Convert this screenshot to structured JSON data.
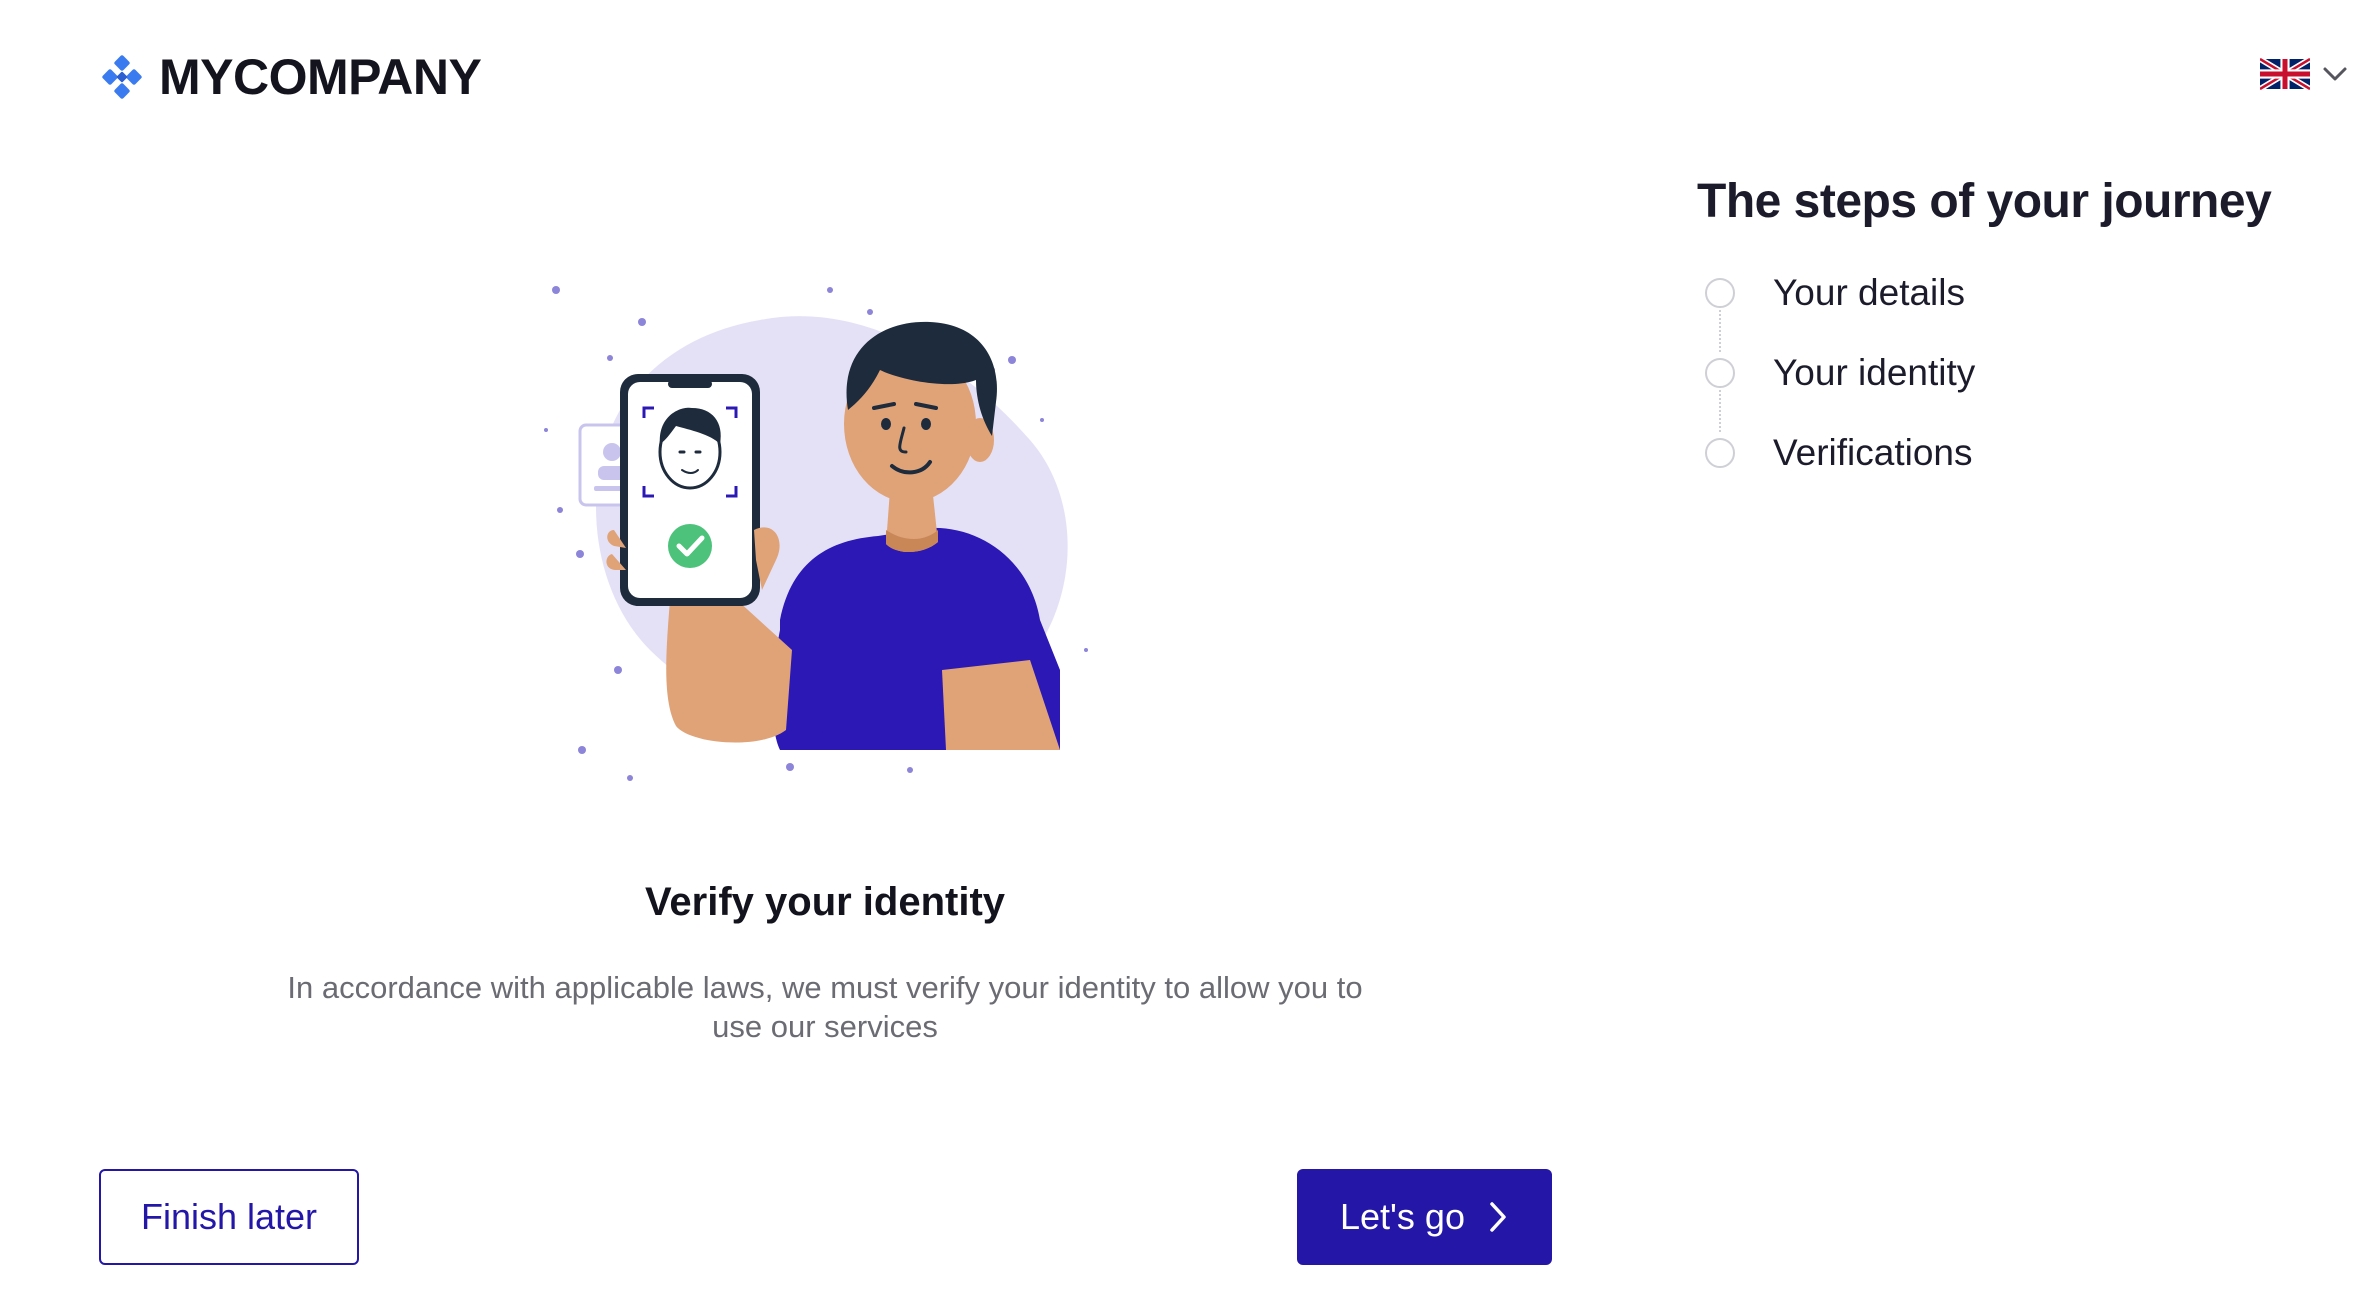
{
  "header": {
    "logo_text": "MYCOMPANY",
    "language": "English (UK)"
  },
  "main": {
    "title": "Verify your identity",
    "description": "In accordance with applicable laws, we must verify your identity to allow you to use our services"
  },
  "actions": {
    "finish_later_label": "Finish later",
    "lets_go_label": "Let's go"
  },
  "steps": {
    "title": "The steps of your journey",
    "items": [
      {
        "label": "Your details"
      },
      {
        "label": "Your identity"
      },
      {
        "label": "Verifications"
      }
    ]
  },
  "icons": {
    "logo": "diamond-grid-logo-icon",
    "language": "uk-flag-icon",
    "dropdown": "chevron-down-icon",
    "next": "chevron-right-icon",
    "success": "check-circle-icon"
  },
  "colors": {
    "primary": "#2417A8",
    "logo_accent": "#3B7BF0",
    "text_dark": "#1B1B2B",
    "text_muted": "#6B6B73",
    "step_circle": "#CFCFD6",
    "illustration_bg": "#E4E1F7",
    "shirt": "#2B18B5",
    "skin": "#DFA377",
    "hair": "#1D2B3C",
    "success": "#4CC27A"
  }
}
